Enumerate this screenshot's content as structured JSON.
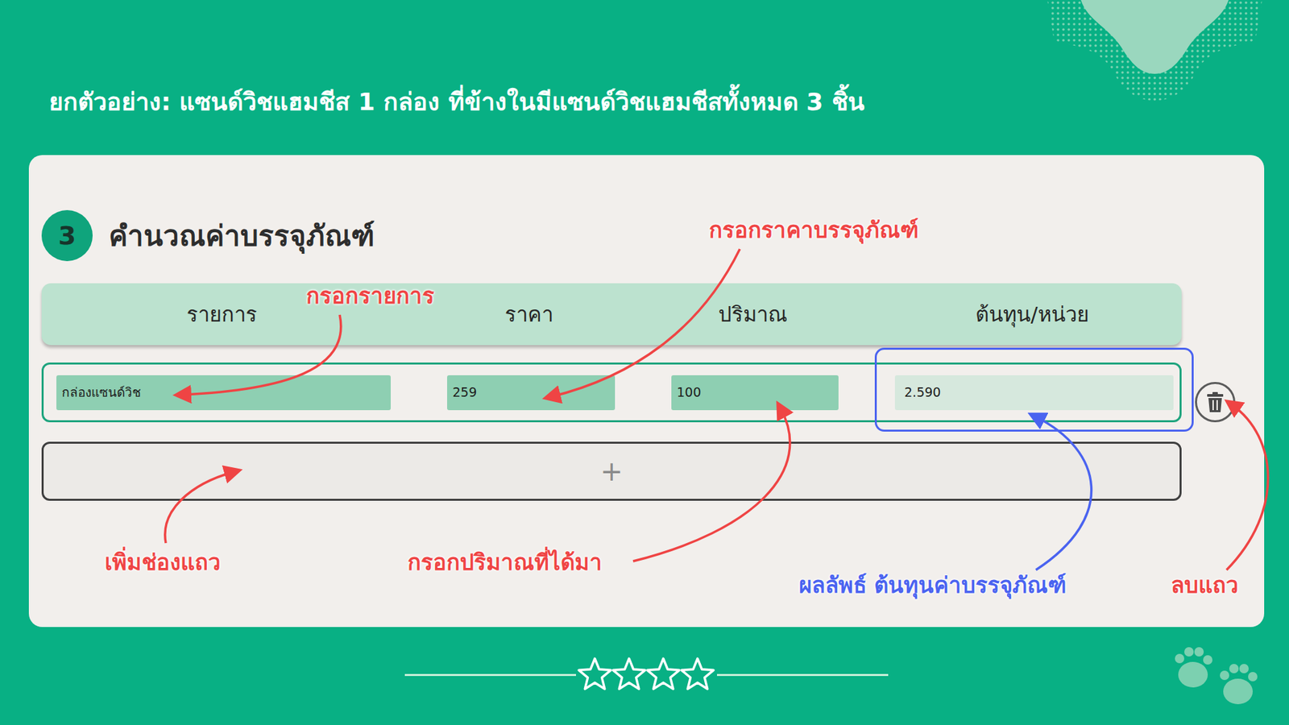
{
  "slide": {
    "title": "ยกตัวอย่าง: แซนด์วิชแฮมชีส 1 กล่อง ที่ข้างในมีแซนด์วิชแฮมชีสทั้งหมด 3 ชิ้น"
  },
  "section": {
    "number": "3",
    "title": "คำนวณค่าบรรจุภัณฑ์"
  },
  "table": {
    "columns": [
      "รายการ",
      "ราคา",
      "ปริมาณ",
      "ต้นทุน/หน่วย"
    ],
    "rows": [
      {
        "name": "กล่องแซนด์วิช",
        "price": "259",
        "quantity": "100",
        "unit_cost": "2.590"
      }
    ]
  },
  "add_row_button": "+",
  "annotations": [
    {
      "text": "กรอกรายการ",
      "color": "#ef4444"
    },
    {
      "text": "กรอกราคาบรรจุภัณฑ์",
      "color": "#ef4444"
    },
    {
      "text": "เพิ่มช่องแถว",
      "color": "#ef4444"
    },
    {
      "text": "กรอกปริมาณที่ได้มา",
      "color": "#ef4444"
    },
    {
      "text": "ผลลัพธ์ ต้นทุนค่าบรรจุภัณฑ์",
      "color": "#4a63f0"
    },
    {
      "text": "ลบแถว",
      "color": "#ef4444"
    }
  ]
}
